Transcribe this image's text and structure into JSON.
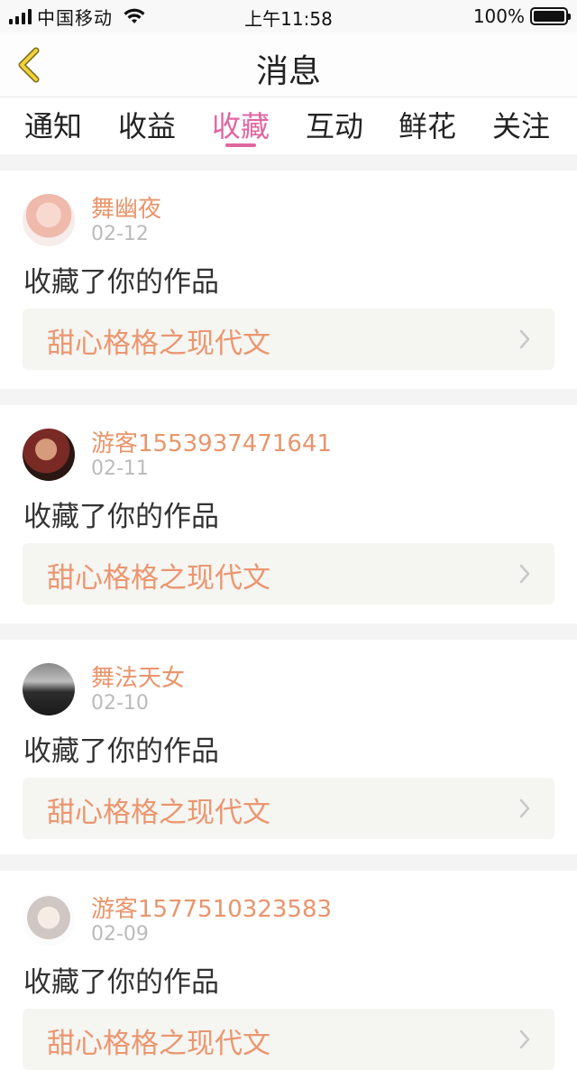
{
  "status_bar": {
    "carrier": "中国移动",
    "time": "上午11:58",
    "battery": "100%"
  },
  "nav": {
    "title": "消息"
  },
  "tabs": [
    {
      "label": "通知",
      "active": false
    },
    {
      "label": "收益",
      "active": false
    },
    {
      "label": "收藏",
      "active": true
    },
    {
      "label": "互动",
      "active": false
    },
    {
      "label": "鲜花",
      "active": false
    },
    {
      "label": "关注",
      "active": false
    }
  ],
  "messages": [
    {
      "name": "舞幽夜",
      "date": "02-12",
      "action": "收藏了你的作品",
      "work": "甜心格格之现代文"
    },
    {
      "name": "游客1553937471641",
      "date": "02-11",
      "action": "收藏了你的作品",
      "work": "甜心格格之现代文"
    },
    {
      "name": "舞法天女",
      "date": "02-10",
      "action": "收藏了你的作品",
      "work": "甜心格格之现代文"
    },
    {
      "name": "游客1577510323583",
      "date": "02-09",
      "action": "收藏了你的作品",
      "work": "甜心格格之现代文"
    }
  ],
  "colors": {
    "accent": "#e066a0",
    "name": "#e8956b",
    "work_title": "#eb9670"
  },
  "icons": {
    "back": "chevron-left-icon",
    "row_arrow": "chevron-right-icon",
    "wifi": "wifi-icon",
    "signal": "signal-icon",
    "battery": "battery-icon"
  }
}
